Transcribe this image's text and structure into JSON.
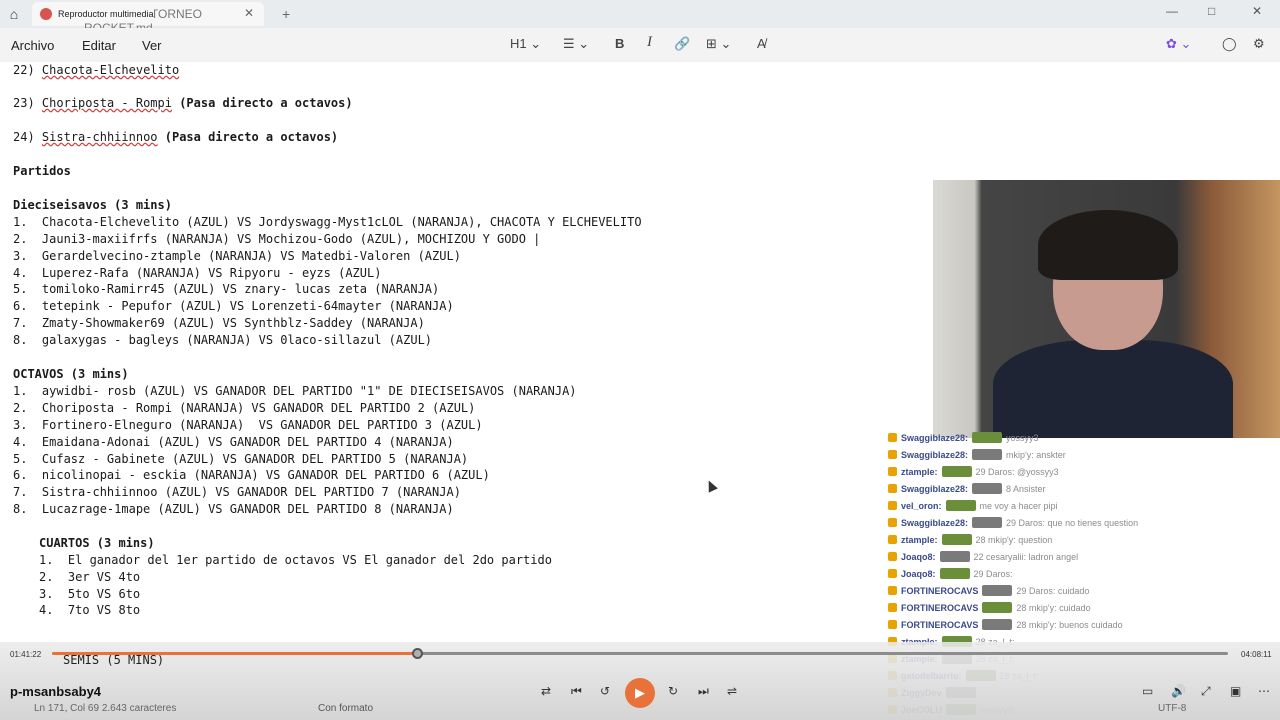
{
  "titlebar": {
    "tab_file": "INVITADOS TORNEO ROCKET.md",
    "tab_media": "Reproductor multimedia",
    "plus": "+"
  },
  "menubar": {
    "items": [
      "Archivo",
      "Editar",
      "Ver"
    ],
    "heading_label": "H1"
  },
  "document": {
    "lines": [
      {
        "n": "22)",
        "text": "Chacota-Elchevelito"
      },
      {
        "n": "23)",
        "text": "Choriposta - Rompi",
        "suffix": "(Pasa directo a octavos)"
      },
      {
        "n": "24)",
        "text": "Sistra-chhiinnoo",
        "suffix": "(Pasa directo a octavos)"
      }
    ],
    "partidos": "Partidos",
    "dieciseisavos_title": "Dieciseisavos (3 mins)",
    "dieciseisavos": [
      "1.  Chacota-Elchevelito (AZUL) VS Jordyswagg-Myst1cLOL (NARANJA), CHACOTA Y ELCHEVELITO",
      "2.  Jauni3-maxiifrfs (NARANJA) VS Mochizou-Godo (AZUL), MOCHIZOU Y GODO |",
      "3.  Gerardelvecino-ztample (NARANJA) VS Matedbi-Valoren (AZUL)",
      "4.  Luperez-Rafa (NARANJA) VS Ripyoru - eyzs (AZUL)",
      "5.  tomiloko-Ramirr45 (AZUL) VS znary- lucas zeta (NARANJA)",
      "6.  tetepink - Pepufor (AZUL) VS Lorenzeti-64mayter (NARANJA)",
      "7.  Zmaty-Showmaker69 (AZUL) VS Synthblz-Saddey (NARANJA)",
      "8.  galaxygas - bagleys (NARANJA) VS 0laco-sillazul (AZUL)"
    ],
    "octavos_title": "OCTAVOS (3 mins)",
    "octavos": [
      "1.  aywidbi- rosb (AZUL) VS GANADOR DEL PARTIDO \"1\" DE DIECISEISAVOS (NARANJA)",
      "2.  Choriposta - Rompi (NARANJA) VS GANADOR DEL PARTIDO 2 (AZUL)",
      "3.  Fortinero-Elneguro (NARANJA)  VS GANADOR DEL PARTIDO 3 (AZUL)",
      "4.  Emaidana-Adonai (AZUL) VS GANADOR DEL PARTIDO 4 (NARANJA)",
      "5.  Cufasz - Gabinete (AZUL) VS GANADOR DEL PARTIDO 5 (NARANJA)",
      "6.  nicolinopai - esckia (NARANJA) VS GANADOR DEL PARTIDO 6 (AZUL)",
      "7.  Sistra-chhiinnoo (AZUL) VS GANADOR DEL PARTIDO 7 (NARANJA)",
      "8.  Lucazrage-1mape (AZUL) VS GANADOR DEL PARTIDO 8 (NARANJA)"
    ],
    "cuartos_title": "CUARTOS (3 mins)",
    "cuartos": [
      "1.  El ganador del 1er partido de octavos VS El ganador del 2do partido",
      "2.  3er VS 4to",
      "3.  5to VS 6to",
      "4.  7to VS 8to"
    ],
    "semis_title": "SEMIS (5 MINS)"
  },
  "chat": [
    {
      "user": "Swaggiblaze28:",
      "text": "yossyy3"
    },
    {
      "user": "Swaggiblaze28:",
      "text": "mkip'y: anskter"
    },
    {
      "user": "ztample:",
      "text": "29 Daros: @yossyy3"
    },
    {
      "user": "Swaggiblaze28:",
      "text": "8 Ansister"
    },
    {
      "user": "vel_oron:",
      "text": "me voy a hacer pipi"
    },
    {
      "user": "Swaggiblaze28:",
      "text": "29 Daros: que no tienes question"
    },
    {
      "user": "ztample:",
      "text": "28 mkip'y: question"
    },
    {
      "user": "Joaqo8:",
      "text": "22 cesaryalii: ladron angel"
    },
    {
      "user": "Joaqo8:",
      "text": "29 Daros:"
    },
    {
      "user": "FORTINEROCAVS",
      "text": "29 Daros: cuidado"
    },
    {
      "user": "FORTINEROCAVS",
      "text": "28 mkip'y: cuidado"
    },
    {
      "user": "FORTINEROCAVS",
      "text": "28 mkip'y: buenos cuidado"
    },
    {
      "user": "ztample:",
      "text": "28 za_l_t:"
    },
    {
      "user": "ztample:",
      "text": "28 za_l_t:"
    },
    {
      "user": "gatodelbarrio:",
      "text": "28 za_l_t:"
    },
    {
      "user": "ZiggyDev",
      "text": ""
    },
    {
      "user": "JoeCOLU",
      "text": "yossyy3:"
    }
  ],
  "player": {
    "current_time": "01:41:22",
    "total_time": "04:08:11",
    "progress_fraction": 0.31,
    "media_title": "p-msanbsaby4",
    "status_left": "Ln 171, Col 69   2.643 caracteres",
    "status_mid": "Con formato",
    "status_right": "UTF-8",
    "accent_color": "#e8733a"
  }
}
